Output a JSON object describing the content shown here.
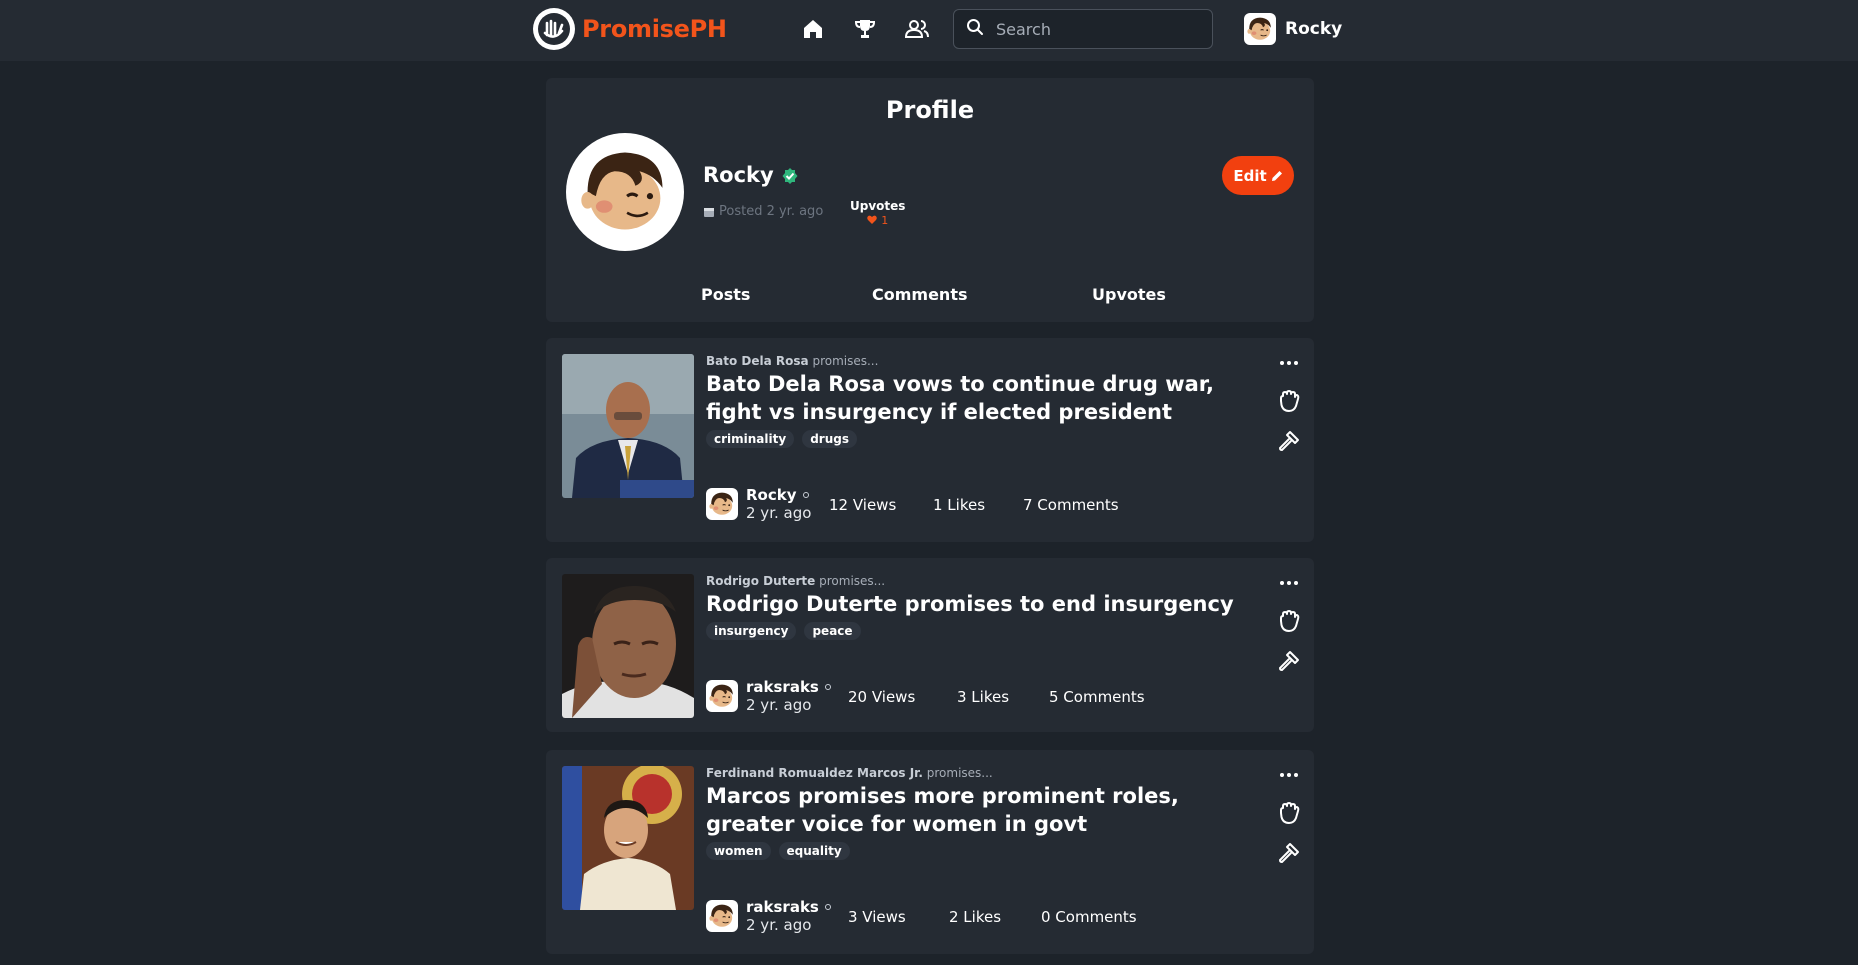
{
  "nav": {
    "brand": "PromisePH",
    "search_placeholder": "Search",
    "user_name": "Rocky",
    "icons": [
      "home-icon",
      "trophy-icon",
      "users-icon",
      "search-icon"
    ]
  },
  "colors": {
    "accent": "#f2541b",
    "background": "#1d232a",
    "card": "#252b33",
    "verified": "#2fb67c"
  },
  "profile": {
    "heading": "Profile",
    "name": "Rocky",
    "posted": "Posted 2 yr. ago",
    "upvotes_label": "Upvotes",
    "upvotes_count": "1",
    "edit_label": "Edit",
    "tabs": [
      "Posts",
      "Comments",
      "Upvotes"
    ]
  },
  "posts": [
    {
      "politician": "Bato Dela Rosa",
      "promises_word": "promises...",
      "title": "Bato Dela Rosa vows to continue drug war, fight vs insurgency if elected president",
      "tags": [
        "criminality",
        "drugs"
      ],
      "author": "Rocky",
      "ago": "2 yr. ago",
      "views": "12 Views",
      "likes": "1 Likes",
      "comments": "7 Comments"
    },
    {
      "politician": "Rodrigo Duterte",
      "promises_word": "promises...",
      "title": "Rodrigo Duterte promises to end insurgency",
      "tags": [
        "insurgency",
        "peace"
      ],
      "author": "raksraks",
      "ago": "2 yr. ago",
      "views": "20 Views",
      "likes": "3 Likes",
      "comments": "5 Comments"
    },
    {
      "politician": "Ferdinand Romualdez Marcos Jr.",
      "promises_word": "promises...",
      "title": "Marcos promises more prominent roles, greater voice for women in govt",
      "tags": [
        "women",
        "equality"
      ],
      "author": "raksraks",
      "ago": "2 yr. ago",
      "views": "3 Views",
      "likes": "2 Likes",
      "comments": "0 Comments"
    }
  ]
}
